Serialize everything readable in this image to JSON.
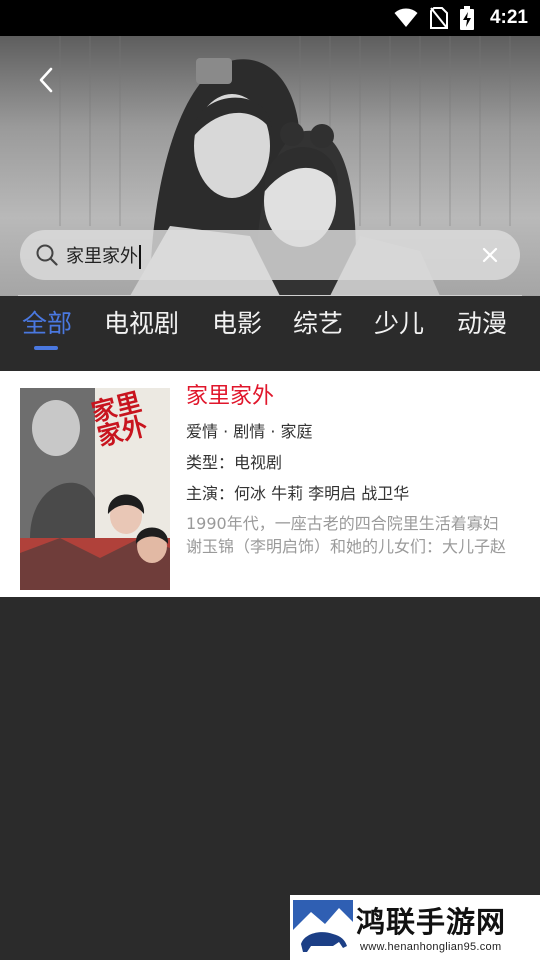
{
  "status_bar": {
    "time": "4:21"
  },
  "search": {
    "query": "家里家外"
  },
  "tabs": [
    {
      "label": "全部",
      "active": true
    },
    {
      "label": "电视剧"
    },
    {
      "label": "电影"
    },
    {
      "label": "综艺"
    },
    {
      "label": "少儿"
    },
    {
      "label": "动漫"
    }
  ],
  "result": {
    "title": "家里家外",
    "genres": "爱情 · 剧情 · 家庭",
    "type": "类型：电视剧",
    "cast": "主演：何冰 牛莉 李明启 战卫华",
    "description_line1": "1990年代，一座古老的四合院里生活着寡妇",
    "description_line2": "谢玉锦（李明启饰）和她的儿女们：大儿子赵",
    "poster_title": "家里家外"
  },
  "watermark": {
    "title": "鸿联手游网",
    "url": "www.henanhonglian95.com"
  },
  "colors": {
    "accent": "#4a78e0",
    "title_red": "#e0162b",
    "background": "#2b2b2b"
  }
}
